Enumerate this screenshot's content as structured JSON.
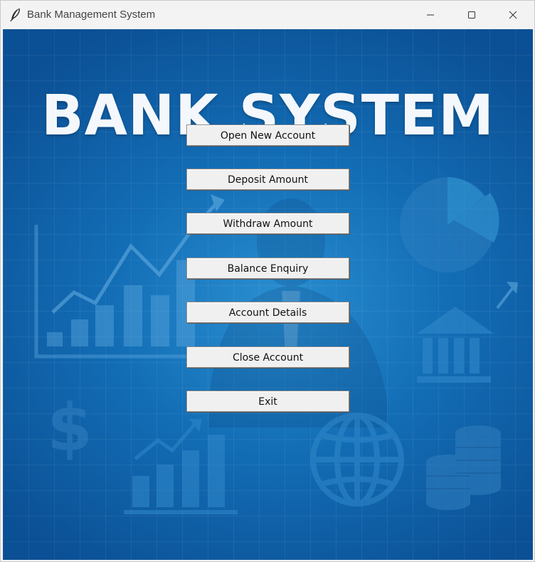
{
  "window": {
    "title": "Bank Management System",
    "icon": "feather-icon",
    "controls": [
      "minimize-icon",
      "maximize-icon",
      "close-icon"
    ]
  },
  "banner": {
    "text": "BANK SYSTEM"
  },
  "menu": {
    "buttons": [
      {
        "label": "Open New Account"
      },
      {
        "label": "Deposit Amount"
      },
      {
        "label": "Withdraw Amount"
      },
      {
        "label": "Balance Enquiry"
      },
      {
        "label": "Account Details"
      },
      {
        "label": "Close Account"
      },
      {
        "label": "Exit"
      }
    ]
  },
  "colors": {
    "background_center": "#2a8fd1",
    "background_edge": "#0b4f94",
    "button_face": "#f0f0f0",
    "banner_text": "#f4f8fc"
  }
}
